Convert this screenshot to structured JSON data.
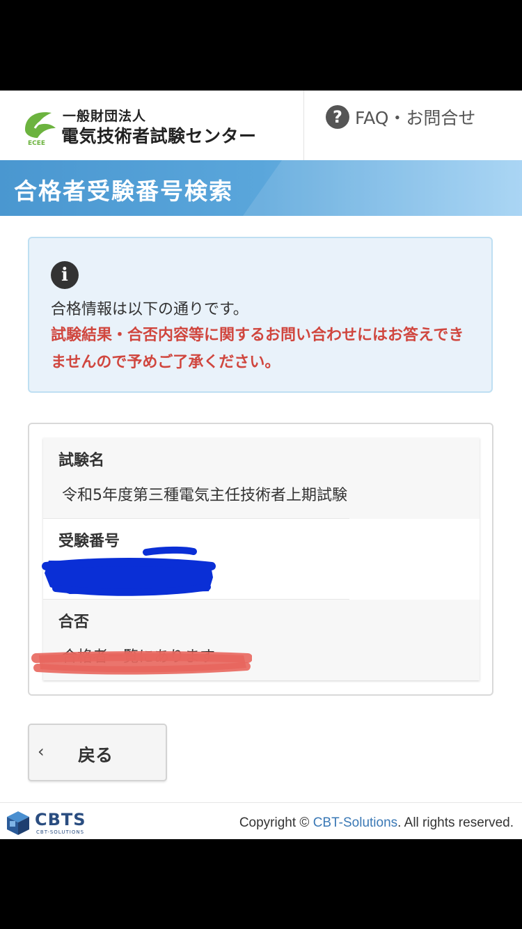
{
  "header": {
    "logo_mark_text": "ECEE",
    "org_small": "一般財団法人",
    "org_name": "電気技術者試験センター",
    "faq_label": "FAQ・お問合せ"
  },
  "title": "合格者受験番号検索",
  "info": {
    "text": "合格情報は以下の通りです。",
    "warning": "試験結果・合否内容等に関するお問い合わせにはお答えできませんので予めご了承ください。"
  },
  "result": {
    "rows": [
      {
        "label": "試験名",
        "value": "令和5年度第三種電気主任技術者上期試験"
      },
      {
        "label": "受験番号",
        "value": ""
      },
      {
        "label": "合否",
        "value": "合格者一覧にあります"
      }
    ]
  },
  "back_label": "戻る",
  "footer": {
    "brand": "CBTS",
    "brand_sub": "CBT-SOLUTIONS",
    "copyright_prefix": "Copyright © ",
    "copyright_link": "CBT-Solutions",
    "copyright_suffix": ". All rights reserved."
  },
  "colors": {
    "title_bar": "#4a97d0",
    "warning": "#d0463e",
    "redaction": "#0a2fd6",
    "highlight": "#e8665d"
  }
}
